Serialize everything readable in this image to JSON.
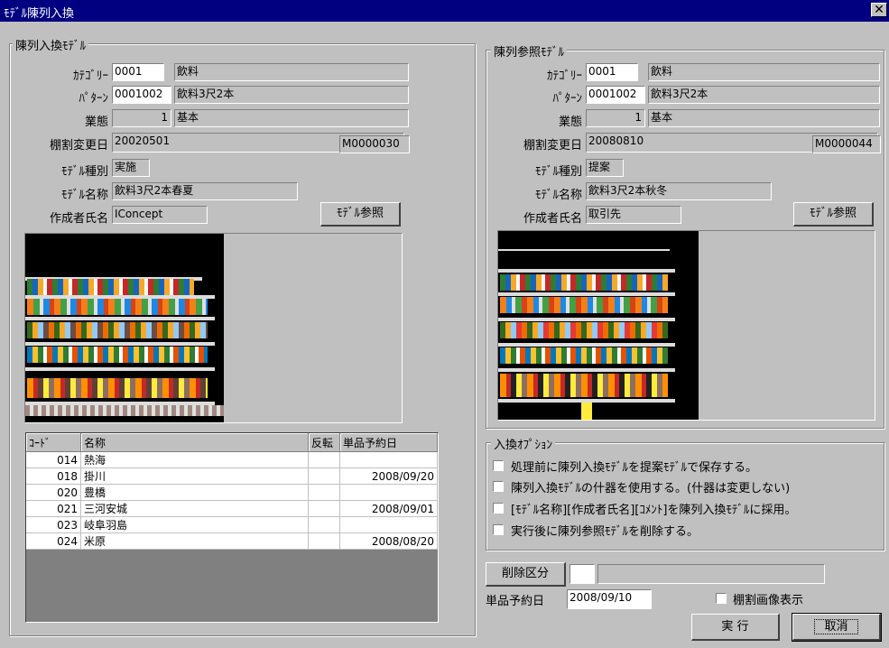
{
  "window": {
    "title": "ﾓﾃﾞﾙ陳列入換",
    "close_glyph": "✕"
  },
  "left": {
    "legend": "陳列入換ﾓﾃﾞﾙ",
    "category_label": "ｶﾃｺﾞﾘｰ",
    "category_code": "0001",
    "category_name": "飲料",
    "pattern_label": "ﾊﾟﾀｰﾝ",
    "pattern_code": "0001002",
    "pattern_name": "飲料3尺2本",
    "business_label": "業態",
    "business_code": "1",
    "business_name": "基本",
    "change_date_label": "棚割変更日",
    "change_date": "20020501",
    "model_code": "M0000030",
    "model_type_label": "ﾓﾃﾞﾙ種別",
    "model_type": "実施",
    "model_name_label": "ﾓﾃﾞﾙ名称",
    "model_name": "飲料3尺2本春夏",
    "author_label": "作成者氏名",
    "author": "IConcept",
    "ref_button": "ﾓﾃﾞﾙ参照",
    "table": {
      "headers": [
        "ｺｰﾄﾞ",
        "名称",
        "反転",
        "単品予約日"
      ],
      "rows": [
        [
          "014",
          "熱海",
          "",
          ""
        ],
        [
          "018",
          "掛川",
          "",
          "2008/09/20"
        ],
        [
          "020",
          "豊橋",
          "",
          ""
        ],
        [
          "021",
          "三河安城",
          "",
          "2008/09/01"
        ],
        [
          "023",
          "岐阜羽島",
          "",
          ""
        ],
        [
          "024",
          "米原",
          "",
          "2008/08/20"
        ]
      ]
    }
  },
  "right": {
    "legend": "陳列参照ﾓﾃﾞﾙ",
    "category_label": "ｶﾃｺﾞﾘｰ",
    "category_code": "0001",
    "category_name": "飲料",
    "pattern_label": "ﾊﾟﾀｰﾝ",
    "pattern_code": "0001002",
    "pattern_name": "飲料3尺2本",
    "business_label": "業態",
    "business_code": "1",
    "business_name": "基本",
    "change_date_label": "棚割変更日",
    "change_date": "20080810",
    "model_code": "M0000044",
    "model_type_label": "ﾓﾃﾞﾙ種別",
    "model_type": "提案",
    "model_name_label": "ﾓﾃﾞﾙ名称",
    "model_name": "飲料3尺2本秋冬",
    "author_label": "作成者氏名",
    "author": "取引先",
    "ref_button": "ﾓﾃﾞﾙ参照"
  },
  "options": {
    "legend": "入換ｵﾌﾟｼｮﾝ",
    "items": [
      "処理前に陳列入換ﾓﾃﾞﾙを提案ﾓﾃﾞﾙで保存する。",
      "陳列入換ﾓﾃﾞﾙの什器を使用する。(什器は変更しない)",
      "[ﾓﾃﾞﾙ名称][作成者氏名][ｺﾒﾝﾄ]を陳列入換ﾓﾃﾞﾙに採用。",
      "実行後に陳列参照ﾓﾃﾞﾙを削除する。"
    ]
  },
  "bottom": {
    "delete_button": "削除区分",
    "reserve_label": "単品予約日",
    "reserve_date": "2008/09/10",
    "show_image_label": "棚割画像表示",
    "run_button": "実 行",
    "cancel_button": "取消"
  },
  "colors": {
    "titlebar": "#000080",
    "face": "#c0c0c0"
  }
}
